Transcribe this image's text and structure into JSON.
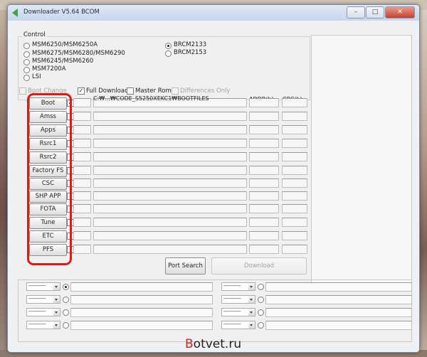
{
  "window": {
    "title": "Downloader V5.64 BCOM",
    "minimize": "–",
    "maximize": "□",
    "close": "✕"
  },
  "control": {
    "label": "Control",
    "models_left": [
      "MSM6250/MSM6250A",
      "MSM6275/MSM6280/MSM6290",
      "MSM6245/MSM6260",
      "MSM7200A",
      "LSI"
    ],
    "models_right": [
      "BRCM2133",
      "BRCM2153"
    ],
    "selected": "BRCM2133"
  },
  "options": {
    "boot_change": "Boot Change",
    "full_download": "Full Download",
    "master_rom": "Master Rom",
    "differences_only": "Differences Only"
  },
  "rows": [
    {
      "label": "Boot",
      "checked": true,
      "path": "C:₩...₩CODE_S5250XEKC1₩BOOTFILES"
    },
    {
      "label": "Amss",
      "checked": false,
      "path": ""
    },
    {
      "label": "Apps",
      "checked": false,
      "path": ""
    },
    {
      "label": "Rsrc1",
      "checked": false,
      "path": ""
    },
    {
      "label": "Rsrc2",
      "checked": false,
      "path": ""
    },
    {
      "label": "Factory FS",
      "checked": false,
      "path": ""
    },
    {
      "label": "CSC",
      "checked": false,
      "path": ""
    },
    {
      "label": "SHP APP",
      "checked": false,
      "path": ""
    },
    {
      "label": "FOTA",
      "checked": false,
      "path": ""
    },
    {
      "label": "Tune",
      "checked": false,
      "path": ""
    },
    {
      "label": "ETC",
      "checked": false,
      "path": ""
    },
    {
      "label": "PFS",
      "checked": false,
      "path": ""
    }
  ],
  "columns": {
    "addr": "ADDR(h)",
    "crc": "CRC(h)"
  },
  "actions": {
    "port_search": "Port Search",
    "download": "Download"
  },
  "ports": {
    "placeholder": "------------",
    "count": 8
  },
  "watermark": {
    "first": "B",
    "rest": "otvet.ru"
  },
  "colors": {
    "highlight": "#e01818",
    "accent": "#3fa63a"
  }
}
